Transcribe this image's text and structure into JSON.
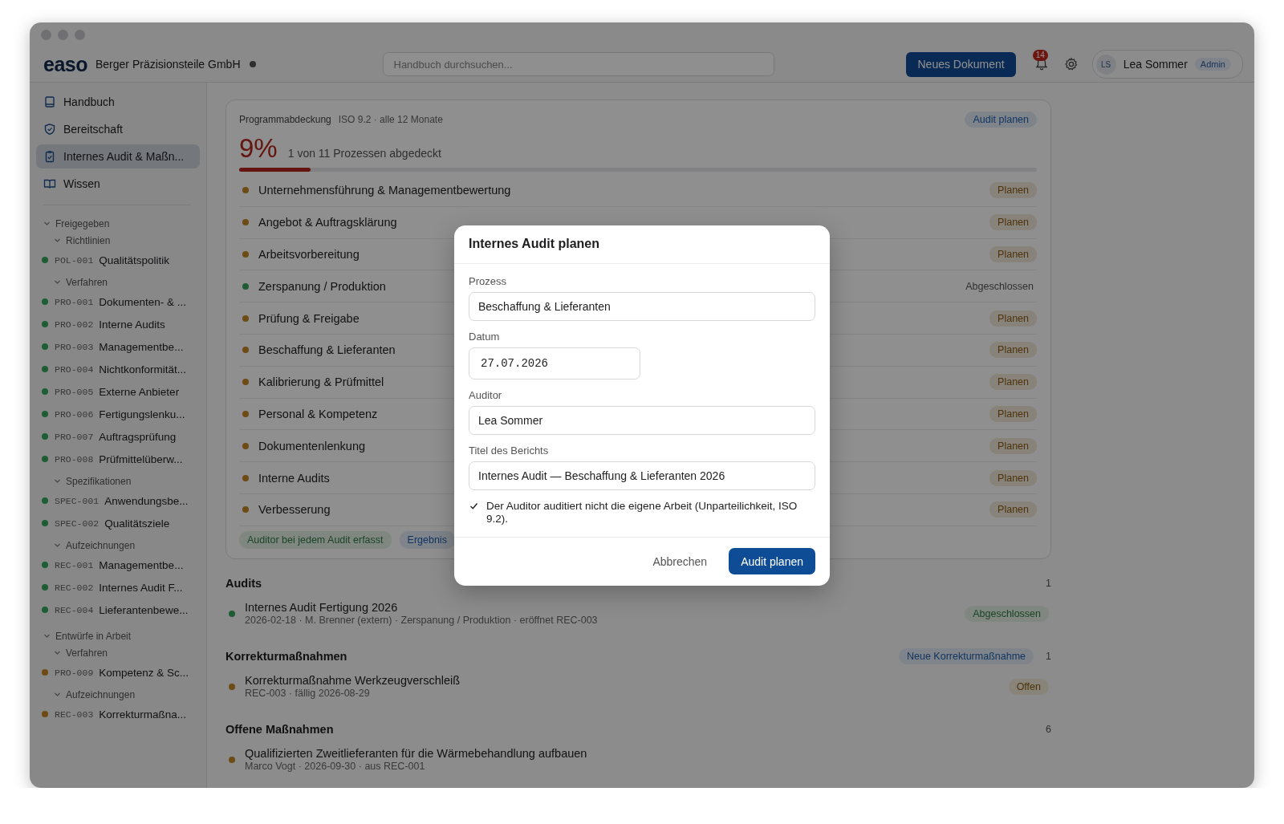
{
  "header": {
    "logo": "easo",
    "company": "Berger Präzisionsteile GmbH",
    "search": {
      "placeholder": "Handbuch durchsuchen..."
    },
    "new_button": "Neues Dokument",
    "notifications": {
      "count": "14"
    },
    "user": {
      "initials": "LS",
      "name": "Lea Sommer",
      "role": "Admin"
    }
  },
  "sidebar": {
    "nav": [
      {
        "label": "Handbuch",
        "kind": "book",
        "selected": false
      },
      {
        "label": "Bereitschaft",
        "kind": "shield",
        "selected": false
      },
      {
        "label": "Internes Audit & Maßn...",
        "kind": "clipboard",
        "selected": true
      },
      {
        "label": "Wissen",
        "kind": "open-book",
        "selected": false
      }
    ],
    "tree": [
      {
        "label": "Freigegeben",
        "expanded": true,
        "children": [
          {
            "label": "Richtlinien",
            "expanded": true,
            "children": [
              {
                "code": "POL-001",
                "title": "Qualitätspolitik",
                "color": "#1e5c34"
              }
            ]
          },
          {
            "label": "Verfahren",
            "expanded": true,
            "children": [
              {
                "code": "PRO-001",
                "title": "Dokumenten- & ...",
                "color": "#1e5c34"
              },
              {
                "code": "PRO-002",
                "title": "Interne Audits",
                "color": "#1e5c34"
              },
              {
                "code": "PRO-003",
                "title": "Managementbe...",
                "color": "#1e5c34"
              },
              {
                "code": "PRO-004",
                "title": "Nichtkonformität...",
                "color": "#1e5c34"
              },
              {
                "code": "PRO-005",
                "title": "Externe Anbieter",
                "color": "#1e5c34"
              },
              {
                "code": "PRO-006",
                "title": "Fertigungslenku...",
                "color": "#1e5c34"
              },
              {
                "code": "PRO-007",
                "title": "Auftragsprüfung",
                "color": "#1e5c34"
              },
              {
                "code": "PRO-008",
                "title": "Prüfmittelüberw...",
                "color": "#1e5c34"
              }
            ]
          },
          {
            "label": "Spezifikationen",
            "expanded": true,
            "children": [
              {
                "code": "SPEC-001",
                "title": "Anwendungsbe...",
                "color": "#1e5c34"
              },
              {
                "code": "SPEC-002",
                "title": "Qualitätsziele",
                "color": "#1e5c34"
              }
            ]
          },
          {
            "label": "Aufzeichnungen",
            "expanded": true,
            "children": [
              {
                "code": "REC-001",
                "title": "Managementbe...",
                "color": "#1e5c34"
              },
              {
                "code": "REC-002",
                "title": "Internes Audit F...",
                "color": "#1e5c34"
              },
              {
                "code": "REC-004",
                "title": "Lieferantenbewe...",
                "color": "#1e5c34"
              }
            ]
          }
        ]
      },
      {
        "label": "Entwürfe in Arbeit",
        "expanded": true,
        "children": [
          {
            "label": "Verfahren",
            "expanded": true,
            "children": [
              {
                "code": "PRO-009",
                "title": "Kompetenz & Sc...",
                "color": "#6e4a14"
              }
            ]
          },
          {
            "label": "Aufzeichnungen",
            "expanded": true,
            "children": [
              {
                "code": "REC-003",
                "title": "Korrekturmaßna...",
                "color": "#6e4a14"
              }
            ]
          }
        ]
      }
    ]
  },
  "coverage": {
    "title": "Programmabdeckung",
    "meta": "ISO 9.2 · alle 12 Monate",
    "action": "Audit planen",
    "percent": "9%",
    "summary": "1 von 11 Prozessen abgedeckt",
    "level": 0.09,
    "processes": [
      {
        "name": "Unternehmensführung & Managementbewertung",
        "color": "#6e4a14",
        "status": "Planen",
        "kind": "action"
      },
      {
        "name": "Angebot & Auftragsklärung",
        "color": "#6e4a14",
        "status": "Planen",
        "kind": "action"
      },
      {
        "name": "Arbeitsvorbereitung",
        "color": "#6e4a14",
        "status": "Planen",
        "kind": "action"
      },
      {
        "name": "Zerspanung / Produktion",
        "color": "#1e5c34",
        "status": "Abgeschlossen",
        "kind": "done"
      },
      {
        "name": "Prüfung & Freigabe",
        "color": "#6e4a14",
        "status": "Planen",
        "kind": "action"
      },
      {
        "name": "Beschaffung & Lieferanten",
        "color": "#6e4a14",
        "status": "Planen",
        "kind": "action"
      },
      {
        "name": "Kalibrierung & Prüfmittel",
        "color": "#6e4a14",
        "status": "Planen",
        "kind": "action"
      },
      {
        "name": "Personal & Kompetenz",
        "color": "#6e4a14",
        "status": "Planen",
        "kind": "action"
      },
      {
        "name": "Dokumentenlenkung",
        "color": "#6e4a14",
        "status": "Planen",
        "kind": "action"
      },
      {
        "name": "Interne Audits",
        "color": "#6e4a14",
        "status": "Planen",
        "kind": "action"
      },
      {
        "name": "Verbesserung",
        "color": "#6e4a14",
        "status": "Planen",
        "kind": "action"
      }
    ],
    "tags": [
      {
        "label": "Auditor bei jedem Audit erfasst",
        "kind": "positive"
      },
      {
        "label": "Ergebnis",
        "kind": "info"
      }
    ]
  },
  "sections": [
    {
      "title": "Audits",
      "count": "1",
      "items": [
        {
          "title": "Internes Audit Fertigung 2026",
          "meta": "2026-02-18 · M. Brenner (extern) · Zerspanung / Produktion · eröffnet REC-003",
          "color": "#1e5c34",
          "status": "Abgeschlossen",
          "kind": "done"
        }
      ]
    },
    {
      "title": "Korrekturmaßnahmen",
      "action": "Neue Korrekturmaßnahme",
      "count": "1",
      "items": [
        {
          "title": "Korrekturmaßnahme Werkzeugverschleiß",
          "meta": "REC-003 · fällig 2026-08-29",
          "color": "#6e4a14",
          "status": "Offen",
          "kind": "open"
        }
      ]
    },
    {
      "title": "Offene Maßnahmen",
      "count": "6",
      "items": [
        {
          "title": "Qualifizierten Zweitlieferanten für die Wärmebehandlung aufbauen",
          "meta": "Marco Vogt · 2026-09-30 · aus REC-001",
          "color": "#6e4a14"
        }
      ]
    }
  ],
  "dialog": {
    "title": "Internes Audit planen",
    "fields": [
      {
        "label": "Prozess",
        "value": "Beschaffung & Lieferanten",
        "kind": "text"
      },
      {
        "label": "Datum",
        "value": "27.07.2026",
        "kind": "date"
      },
      {
        "label": "Auditor",
        "value": "Lea Sommer",
        "kind": "text"
      },
      {
        "label": "Titel des Berichts",
        "value": "Internes Audit — Beschaffung & Lieferanten 2026",
        "kind": "text"
      }
    ],
    "confirm": {
      "label": "Der Auditor auditiert nicht die eigene Arbeit (Unparteilichkeit, ISO 9.2).",
      "checked": true
    },
    "cancel": "Abbrechen",
    "submit": "Audit planen"
  }
}
